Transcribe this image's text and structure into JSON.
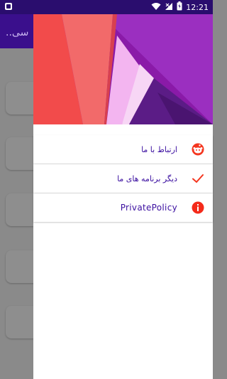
{
  "status_bar": {
    "time": "12:21",
    "left_icon": "app-notification-icon",
    "icons": [
      "wifi-icon",
      "signal-icon",
      "battery-icon"
    ]
  },
  "app": {
    "toolbar_title": "..سی"
  },
  "drawer": {
    "items": [
      {
        "label": "ارتباط با ما",
        "icon": "reddit-face-icon",
        "icon_color": "#f4361f"
      },
      {
        "label": "دیگر برنامه های ما",
        "icon": "check-icon",
        "icon_color": "#f4361f"
      },
      {
        "label": "PrivatePolicy",
        "icon": "info-icon",
        "icon_color": "#f42a1a"
      }
    ]
  },
  "colors": {
    "status_bar": "#2a0d6e",
    "toolbar": "#3a0f8c",
    "menu_text": "#3b0fa0",
    "accent": "#f4361f"
  }
}
